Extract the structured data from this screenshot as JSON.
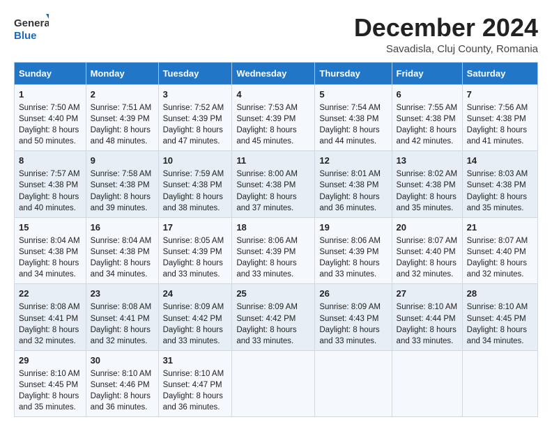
{
  "logo": {
    "line1": "General",
    "line2": "Blue"
  },
  "title": "December 2024",
  "subtitle": "Savadisla, Cluj County, Romania",
  "days_of_week": [
    "Sunday",
    "Monday",
    "Tuesday",
    "Wednesday",
    "Thursday",
    "Friday",
    "Saturday"
  ],
  "weeks": [
    [
      {
        "day": "1",
        "sunrise": "7:50 AM",
        "sunset": "4:40 PM",
        "daylight": "8 hours and 50 minutes."
      },
      {
        "day": "2",
        "sunrise": "7:51 AM",
        "sunset": "4:39 PM",
        "daylight": "8 hours and 48 minutes."
      },
      {
        "day": "3",
        "sunrise": "7:52 AM",
        "sunset": "4:39 PM",
        "daylight": "8 hours and 47 minutes."
      },
      {
        "day": "4",
        "sunrise": "7:53 AM",
        "sunset": "4:39 PM",
        "daylight": "8 hours and 45 minutes."
      },
      {
        "day": "5",
        "sunrise": "7:54 AM",
        "sunset": "4:38 PM",
        "daylight": "8 hours and 44 minutes."
      },
      {
        "day": "6",
        "sunrise": "7:55 AM",
        "sunset": "4:38 PM",
        "daylight": "8 hours and 42 minutes."
      },
      {
        "day": "7",
        "sunrise": "7:56 AM",
        "sunset": "4:38 PM",
        "daylight": "8 hours and 41 minutes."
      }
    ],
    [
      {
        "day": "8",
        "sunrise": "7:57 AM",
        "sunset": "4:38 PM",
        "daylight": "8 hours and 40 minutes."
      },
      {
        "day": "9",
        "sunrise": "7:58 AM",
        "sunset": "4:38 PM",
        "daylight": "8 hours and 39 minutes."
      },
      {
        "day": "10",
        "sunrise": "7:59 AM",
        "sunset": "4:38 PM",
        "daylight": "8 hours and 38 minutes."
      },
      {
        "day": "11",
        "sunrise": "8:00 AM",
        "sunset": "4:38 PM",
        "daylight": "8 hours and 37 minutes."
      },
      {
        "day": "12",
        "sunrise": "8:01 AM",
        "sunset": "4:38 PM",
        "daylight": "8 hours and 36 minutes."
      },
      {
        "day": "13",
        "sunrise": "8:02 AM",
        "sunset": "4:38 PM",
        "daylight": "8 hours and 35 minutes."
      },
      {
        "day": "14",
        "sunrise": "8:03 AM",
        "sunset": "4:38 PM",
        "daylight": "8 hours and 35 minutes."
      }
    ],
    [
      {
        "day": "15",
        "sunrise": "8:04 AM",
        "sunset": "4:38 PM",
        "daylight": "8 hours and 34 minutes."
      },
      {
        "day": "16",
        "sunrise": "8:04 AM",
        "sunset": "4:38 PM",
        "daylight": "8 hours and 34 minutes."
      },
      {
        "day": "17",
        "sunrise": "8:05 AM",
        "sunset": "4:39 PM",
        "daylight": "8 hours and 33 minutes."
      },
      {
        "day": "18",
        "sunrise": "8:06 AM",
        "sunset": "4:39 PM",
        "daylight": "8 hours and 33 minutes."
      },
      {
        "day": "19",
        "sunrise": "8:06 AM",
        "sunset": "4:39 PM",
        "daylight": "8 hours and 33 minutes."
      },
      {
        "day": "20",
        "sunrise": "8:07 AM",
        "sunset": "4:40 PM",
        "daylight": "8 hours and 32 minutes."
      },
      {
        "day": "21",
        "sunrise": "8:07 AM",
        "sunset": "4:40 PM",
        "daylight": "8 hours and 32 minutes."
      }
    ],
    [
      {
        "day": "22",
        "sunrise": "8:08 AM",
        "sunset": "4:41 PM",
        "daylight": "8 hours and 32 minutes."
      },
      {
        "day": "23",
        "sunrise": "8:08 AM",
        "sunset": "4:41 PM",
        "daylight": "8 hours and 32 minutes."
      },
      {
        "day": "24",
        "sunrise": "8:09 AM",
        "sunset": "4:42 PM",
        "daylight": "8 hours and 33 minutes."
      },
      {
        "day": "25",
        "sunrise": "8:09 AM",
        "sunset": "4:42 PM",
        "daylight": "8 hours and 33 minutes."
      },
      {
        "day": "26",
        "sunrise": "8:09 AM",
        "sunset": "4:43 PM",
        "daylight": "8 hours and 33 minutes."
      },
      {
        "day": "27",
        "sunrise": "8:10 AM",
        "sunset": "4:44 PM",
        "daylight": "8 hours and 33 minutes."
      },
      {
        "day": "28",
        "sunrise": "8:10 AM",
        "sunset": "4:45 PM",
        "daylight": "8 hours and 34 minutes."
      }
    ],
    [
      {
        "day": "29",
        "sunrise": "8:10 AM",
        "sunset": "4:45 PM",
        "daylight": "8 hours and 35 minutes."
      },
      {
        "day": "30",
        "sunrise": "8:10 AM",
        "sunset": "4:46 PM",
        "daylight": "8 hours and 36 minutes."
      },
      {
        "day": "31",
        "sunrise": "8:10 AM",
        "sunset": "4:47 PM",
        "daylight": "8 hours and 36 minutes."
      },
      null,
      null,
      null,
      null
    ]
  ],
  "labels": {
    "sunrise": "Sunrise:",
    "sunset": "Sunset:",
    "daylight": "Daylight:"
  }
}
